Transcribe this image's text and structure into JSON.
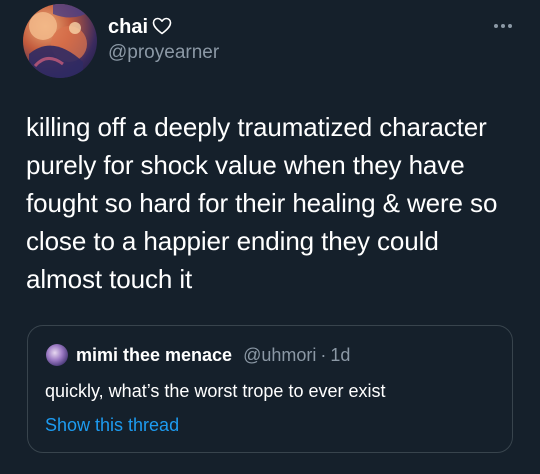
{
  "tweet": {
    "author_name": "chai",
    "author_badge_icon": "heart-outline-icon",
    "author_handle": "@proyearner",
    "more_icon": "more-horizontal-icon",
    "text": "killing off a deeply traumatized character purely for shock value when they have fought so hard for their healing & were so close to a happier ending they could almost touch it"
  },
  "quote": {
    "author_name": "mimi thee menace",
    "author_handle": "@uhmori",
    "separator": "·",
    "time": "1d",
    "text": "quickly, what’s the worst trope to ever exist",
    "show_thread_label": "Show this thread"
  },
  "colors": {
    "background": "#15202b",
    "primary_text": "#ffffff",
    "secondary_text": "#8b98a5",
    "border": "#38444d",
    "link": "#1d9bf0"
  }
}
